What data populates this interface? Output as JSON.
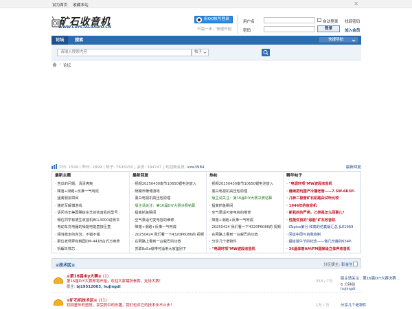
{
  "topbar": {
    "set_home": "设为首页",
    "bookmark": "收藏本站",
    "close_symbol": "✕"
  },
  "logo": {
    "title": "矿石收音机",
    "url": "WWW.CRYSTALRADIO.CN"
  },
  "login": {
    "qq_button": "用QQ帐号登录",
    "qq_sub": "只需一步，快速开始",
    "username_label": "用户名",
    "password_label": "密码",
    "auto_login": "自动登录",
    "find_password": "找回密码",
    "login_button": "登录",
    "register": "加入会员"
  },
  "nav": {
    "tabs": [
      "论坛",
      "搜索"
    ],
    "quick_nav": "快捷导航"
  },
  "search": {
    "placeholder": "请输入搜索内容",
    "type": "帖子"
  },
  "breadcrumb": {
    "current": "论坛"
  },
  "stats": {
    "text": "今日: 1599 | 昨日: 1899 | 帖子: 7636150 | 会员: 394747 | 欢迎新会员: ",
    "newest_member": "xzw3984",
    "latest_replies_link": "最新回复"
  },
  "columns": [
    {
      "title": "最新主题",
      "items": [
        {
          "text": "苦瓜的问题，清清爽爽",
          "style": "plain"
        },
        {
          "text": "降落+滑跑+反推一气呵成",
          "style": "plain"
        },
        {
          "text": "猛禽朋友瞬间",
          "style": "plain"
        },
        {
          "text": "描述写解博游戏",
          "style": "plain"
        },
        {
          "text": "请问当年美国赐给东芝的收音机的型号",
          "style": "plain"
        },
        {
          "text": "哪位同学有德生收音机BCL3000说明书",
          "style": "plain"
        },
        {
          "text": "电动车充电器的噪能电能直接压直",
          "style": "plain"
        },
        {
          "text": "相当稳定的自治，不错不错",
          "style": "plain"
        },
        {
          "text": "那位老师弄有韩国DM-441B台式万用表",
          "style": "plain"
        },
        {
          "text": "拆解日铁芯",
          "style": "plain"
        }
      ]
    },
    {
      "title": "最新回复",
      "items": [
        {
          "text": "视频20250430南节10650锂电池放入",
          "style": "plain"
        },
        {
          "text": "随硬币赚博游戏",
          "style": "plain"
        },
        {
          "text": "黑白电视机高压包原理",
          "style": "plain"
        },
        {
          "text": "版主请关注：第16届DIY大赛决赛帖幕",
          "style": "green"
        },
        {
          "text": "猛禽抓鱼瞬间",
          "style": "plain"
        },
        {
          "text": "空气泵适可变电容的维修",
          "style": "plain"
        },
        {
          "text": "降落+滑跑+反推一气呵成",
          "style": "plain"
        },
        {
          "text": "20250424 我们看一下4320P6086的 视频",
          "style": "plain"
        },
        {
          "text": "在网路上看到一台蜕巴的功放",
          "style": "plain"
        },
        {
          "text": "苏联8xSx级带可适用大家鉴别下",
          "style": "plain"
        }
      ]
    },
    {
      "title": "热帖",
      "items": [
        {
          "text": "视频20250430南节10650锂电池放入",
          "style": "plain"
        },
        {
          "text": "黑白电视机高压包原理",
          "style": "plain"
        },
        {
          "text": "版主请关注：第16届DIY大赛决赛帖幕",
          "style": "green"
        },
        {
          "text": "猛禽抓鱼瞬间",
          "style": "plain"
        },
        {
          "text": "空气泵适可变电容的维修",
          "style": "plain"
        },
        {
          "text": "降落+滑跑+反推一气呵成",
          "style": "plain"
        },
        {
          "text": "20250424 我们看一下4320P6086的 视频",
          "style": "plain"
        },
        {
          "text": "在网路上看到一台蜕巴的功放",
          "style": "plain"
        },
        {
          "text": "分享几个老物件",
          "style": "plain"
        },
        {
          "text": "\"电调环项\"MW波段收音机",
          "style": "red"
        }
      ]
    },
    {
      "title": "精华帖子",
      "items": [
        {
          "text": "\"电调环项\"MW波段收音机",
          "style": "red"
        },
        {
          "text": "继续把玩国产冷播老管——7.5W-6K3P-",
          "style": "red"
        },
        {
          "text": "几种二极管矿石机路由试听比较",
          "style": "red"
        },
        {
          "text": "1946年的收音机",
          "style": "red"
        },
        {
          "text": "新机的的严类，乙类是怎么回事儿？",
          "style": "red"
        },
        {
          "text": "性能优良的\"追能\"矿石收音机",
          "style": "red"
        },
        {
          "text": "LTspice第分 和高的仿真版汇总 JL01969",
          "style": "blue"
        },
        {
          "text": "闲谈中周与自我绕制",
          "style": "blue"
        },
        {
          "text": "留给端午节的纪念——做几份廉的634P-",
          "style": "blue"
        },
        {
          "text": "36晶体管AM/FM国家级立体声收音机",
          "style": "red"
        }
      ]
    }
  ],
  "section": {
    "title": "≡技术区≡",
    "moderator_label": "分区版主: ",
    "moderator": "彭金生"
  },
  "forums": [
    {
      "name": "≡第16届diy大赛≡",
      "today": "(1)",
      "desc": "第16届DIY大赛即将开始，欢迎大家踊跃参赛，支持大赛！",
      "mod_label": "版主: ",
      "mods": "bj19512003, hujingdi",
      "count": "253 / 7万",
      "last_title": "版主请关注：第16届DIY大赛决赛 ...",
      "last_time": "6 分钟前 ",
      "last_user": "hujingdi"
    },
    {
      "name": "≡矿石机技术区≡",
      "today": "(11)",
      "desc": "找回童年的感觉，享受其中的乐趣，我们也对它的技术永不止步！",
      "count": "1万 / 万",
      "last_title": "分享几个老物件"
    }
  ]
}
